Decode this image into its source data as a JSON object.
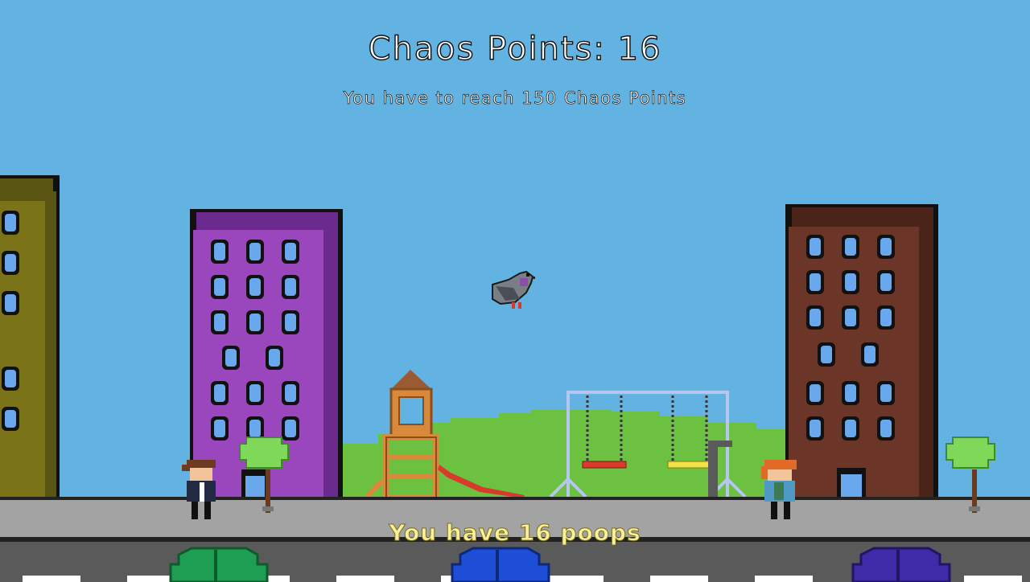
{
  "hud": {
    "chaos_points_text": "Chaos Points: 16",
    "goal_text": "You have to reach 150 Chaos Points",
    "poops_text": "You have 16 poops"
  },
  "state": {
    "chaos_points": 16,
    "chaos_goal": 150,
    "poops": 16
  },
  "colors": {
    "sky": "#62b2e2",
    "building_left": "#7a7318",
    "building_purple": "#9a46bd",
    "building_brown": "#6b3527",
    "window": "#6aa8ee",
    "grass": "#6cc140",
    "sidewalk": "#a3a3a3",
    "road": "#5a5a5a",
    "poops_text": "#f7ef9a"
  },
  "icons": [
    "pigeon-icon",
    "tree-icon",
    "swing-set-icon",
    "slide-tower-icon",
    "car-icon",
    "person-icon"
  ]
}
